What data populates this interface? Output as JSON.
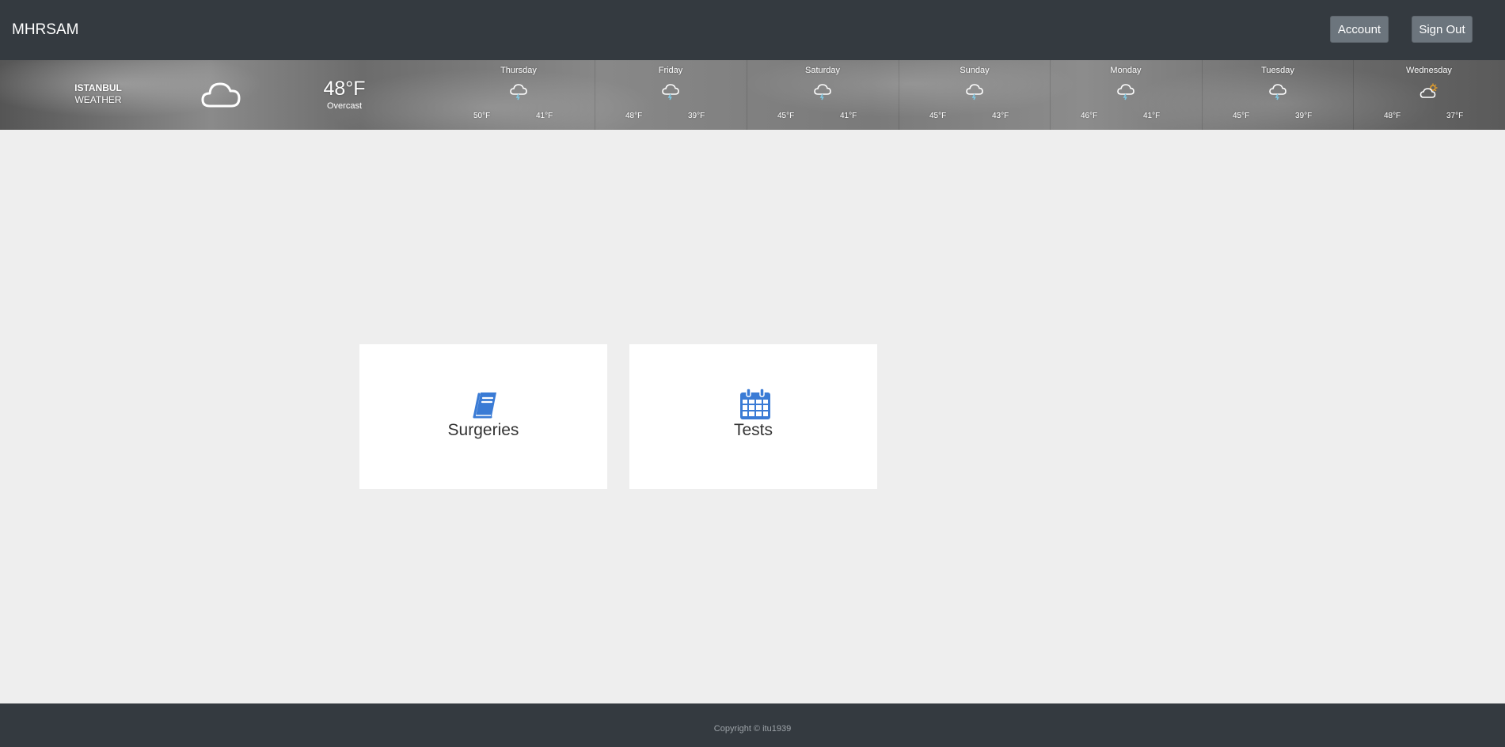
{
  "navbar": {
    "brand": "MHRSAM",
    "account_label": "Account",
    "signout_label": "Sign Out"
  },
  "weather": {
    "city": "ISTANBUL",
    "label": "WEATHER",
    "current_icon": "cloud-icon",
    "current_temp": "48°F",
    "current_desc": "Overcast",
    "forecast": [
      {
        "day": "Thursday",
        "icon": "rain-cloud-icon",
        "high": "50°F",
        "low": "41°F"
      },
      {
        "day": "Friday",
        "icon": "rain-cloud-icon",
        "high": "48°F",
        "low": "39°F"
      },
      {
        "day": "Saturday",
        "icon": "rain-cloud-icon",
        "high": "45°F",
        "low": "41°F"
      },
      {
        "day": "Sunday",
        "icon": "rain-cloud-icon",
        "high": "45°F",
        "low": "43°F"
      },
      {
        "day": "Monday",
        "icon": "rain-cloud-icon",
        "high": "46°F",
        "low": "41°F"
      },
      {
        "day": "Tuesday",
        "icon": "rain-cloud-icon",
        "high": "45°F",
        "low": "39°F"
      },
      {
        "day": "Wednesday",
        "icon": "partly-sunny-cloud-icon",
        "high": "48°F",
        "low": "37°F"
      }
    ]
  },
  "cards": [
    {
      "label": "Surgeries",
      "icon": "book-icon"
    },
    {
      "label": "Tests",
      "icon": "calendar-icon"
    }
  ],
  "colors": {
    "accent": "#3a7bd5",
    "navbar": "#343a40",
    "background": "#eeeeee",
    "rain_drop": "#7ec8e3",
    "sun": "#f5a623"
  },
  "footer": {
    "copyright": "Copyright © itu1939"
  }
}
